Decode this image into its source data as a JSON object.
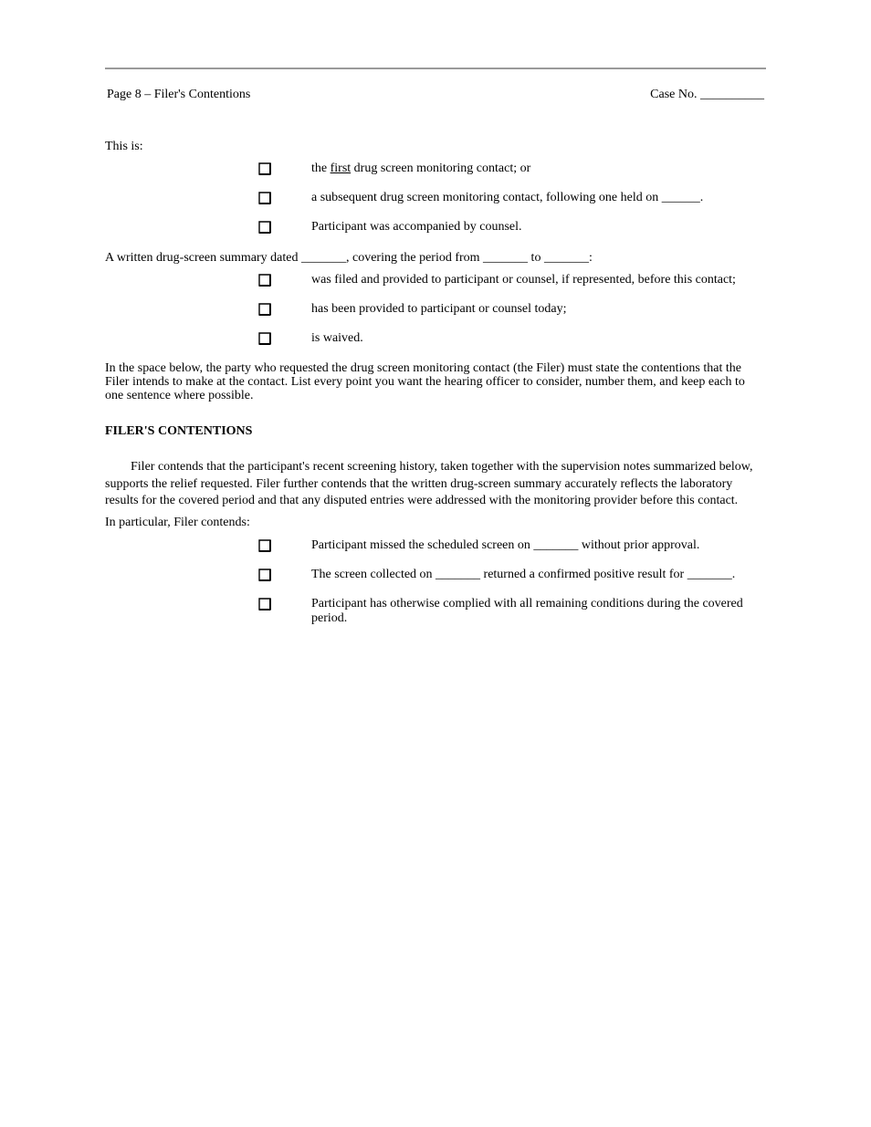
{
  "header": {
    "title": "Page 8 – Filer's Contentions",
    "caseno": "Case No. __________"
  },
  "bullets1": {
    "lead": "This is:",
    "items": [
      "the first drug screen monitoring contact; or",
      "a subsequent drug screen monitoring contact, following one held on ______.",
      "Participant was accompanied by counsel."
    ]
  },
  "bullets2": {
    "lead": "A written drug-screen summary dated _______, covering the period from _______ to _______:",
    "items": [
      "was filed and provided to participant or counsel, if represented, before this contact;",
      "has been provided to participant or counsel today;",
      "is waived."
    ]
  },
  "intro": "In the space below, the party who requested the drug screen monitoring contact (the Filer) must state the contentions that the Filer intends to make at the contact. List every point you want the hearing officer to consider, number them, and keep each to one sentence where possible.",
  "section_heading": "FILER'S CONTENTIONS",
  "para": "Filer contends that the participant's recent screening history, taken together with the supervision notes summarized below, supports the relief requested. Filer further contends that the written drug-screen summary accurately reflects the laboratory results for the covered period and that any disputed entries were addressed with the monitoring provider before this contact.",
  "list_intro": "In particular, Filer contends:",
  "bullets3": {
    "items": [
      "Participant missed the scheduled screen on _______ without prior approval.",
      "The screen collected on _______ returned a confirmed positive result for _______.",
      "Participant has otherwise complied with all remaining conditions during the covered period."
    ]
  }
}
